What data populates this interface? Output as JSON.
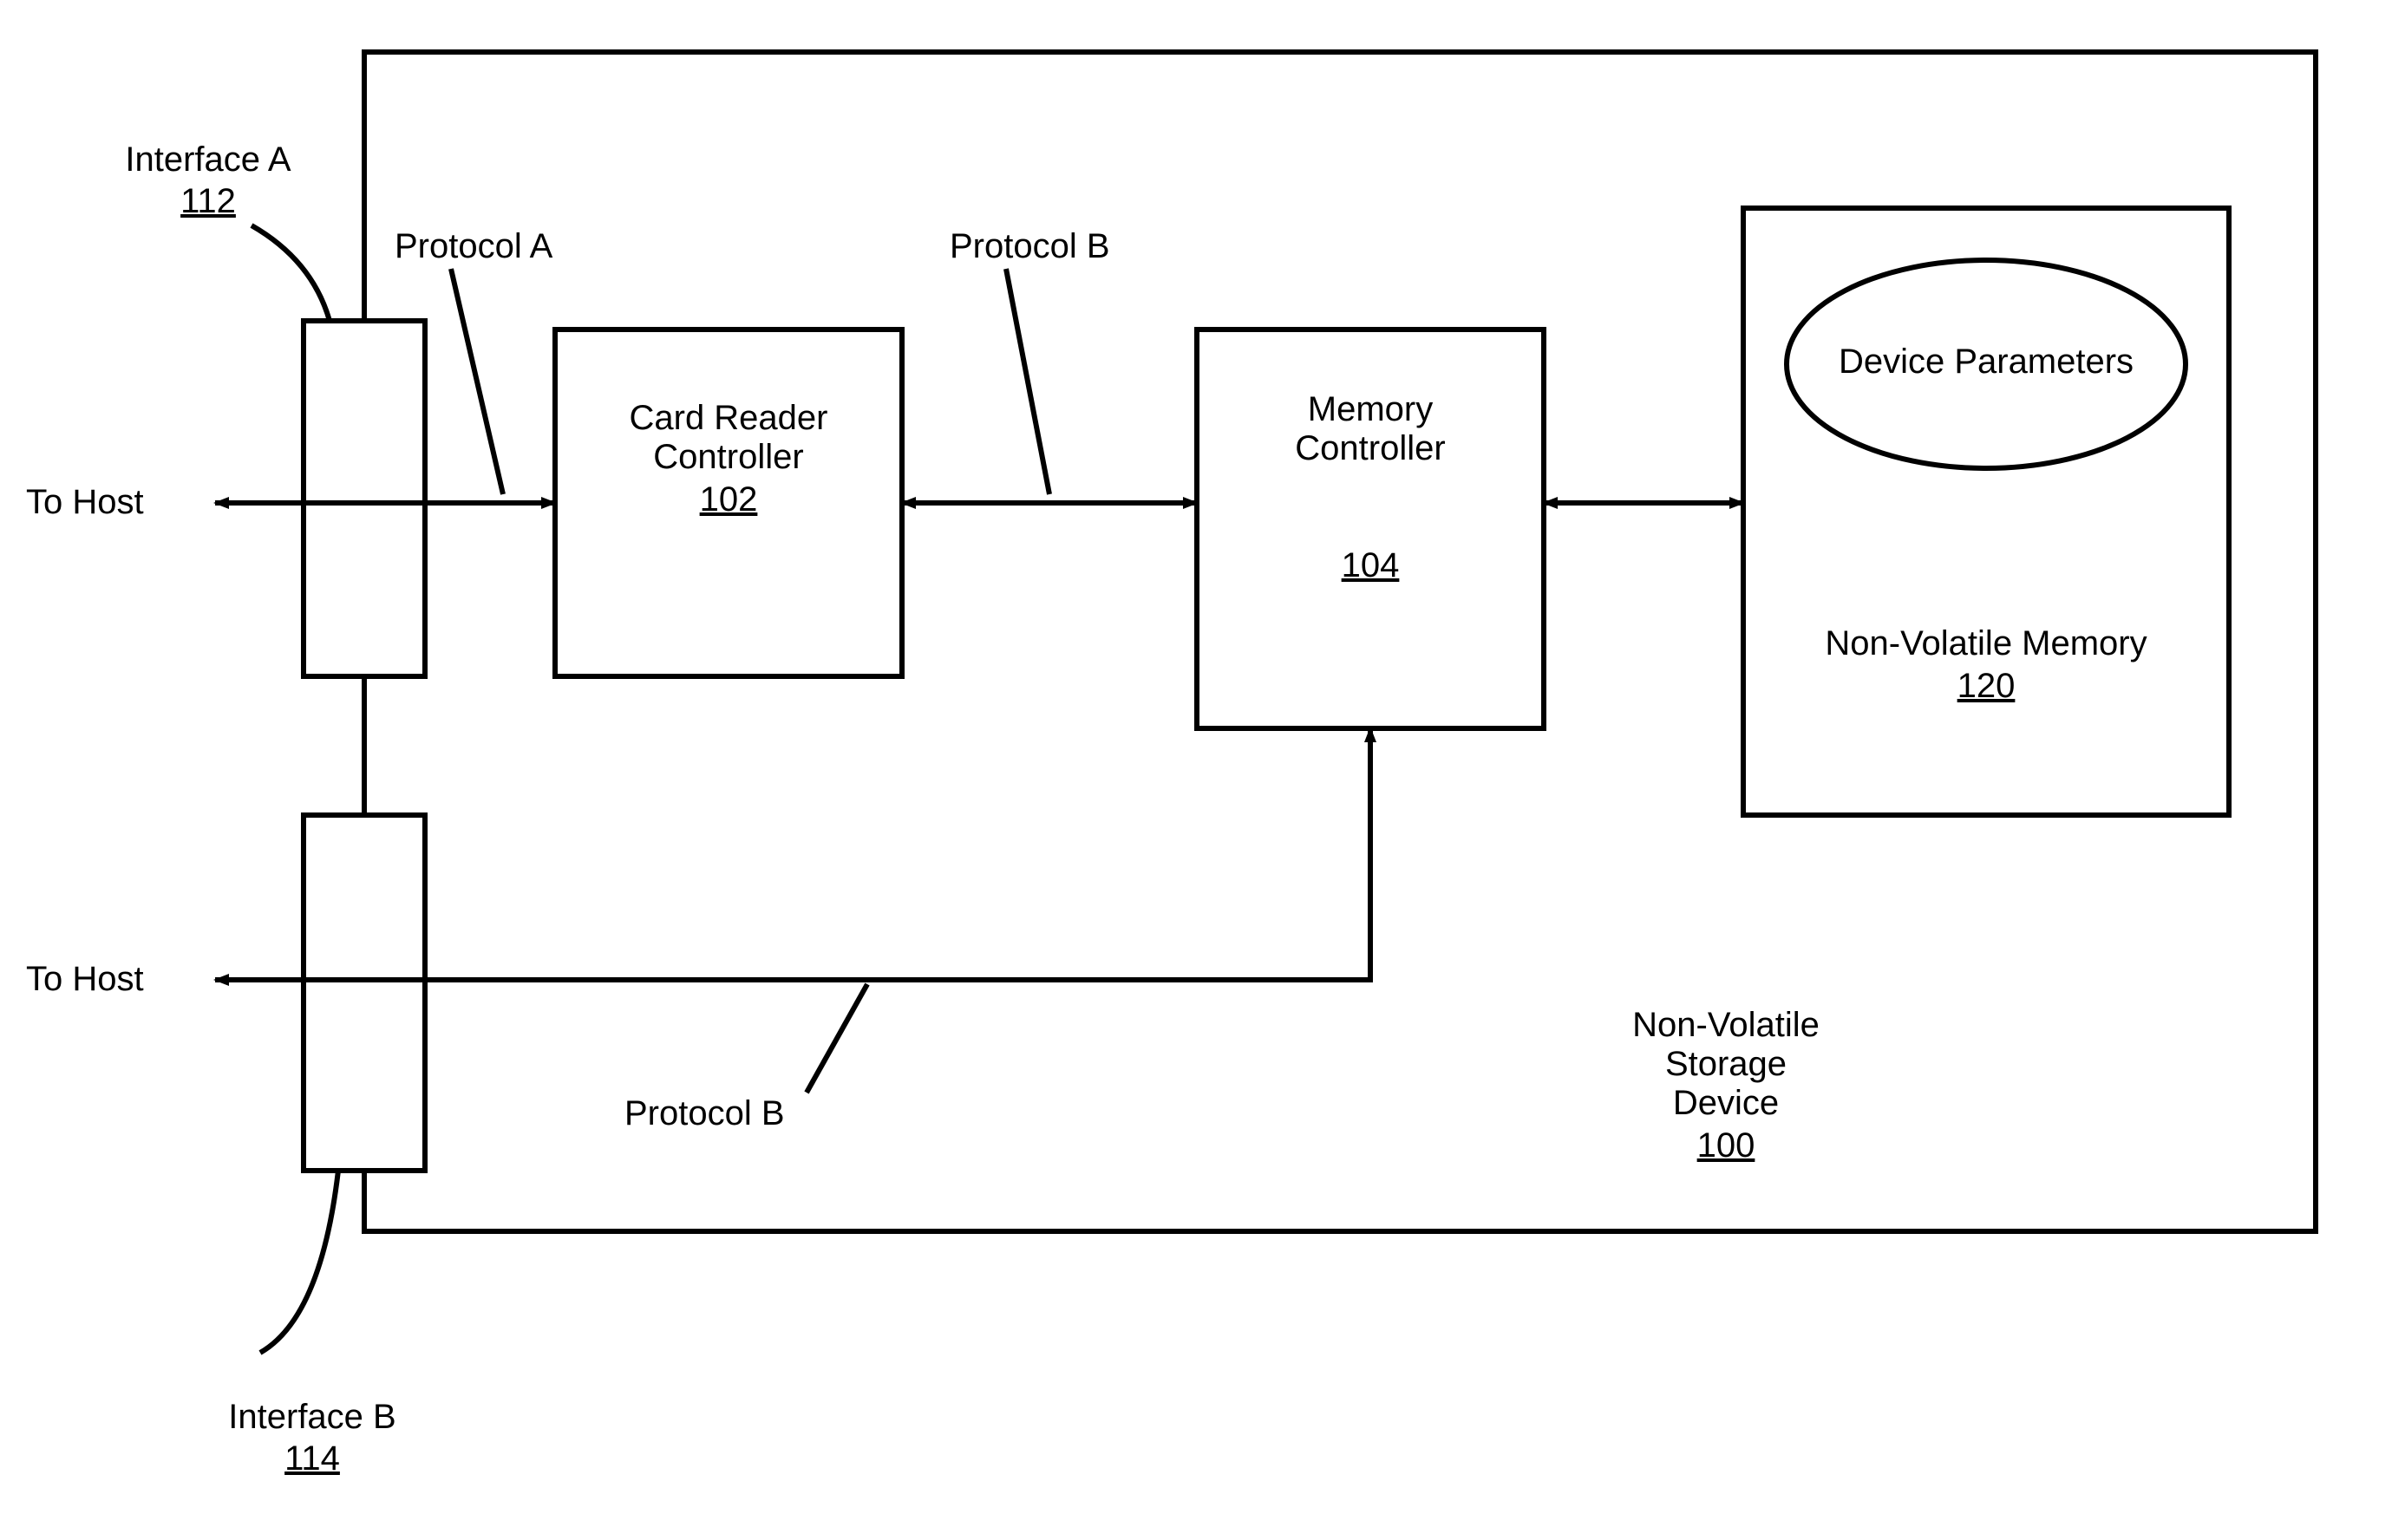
{
  "external": {
    "to_host_top": "To Host",
    "to_host_bottom": "To Host",
    "interface_a_label": "Interface A",
    "interface_a_ref": "112",
    "interface_b_label": "Interface B",
    "interface_b_ref": "114"
  },
  "protocols": {
    "a": "Protocol A",
    "b_top": "Protocol B",
    "b_bottom": "Protocol B"
  },
  "blocks": {
    "card_reader": {
      "title_line1": "Card Reader",
      "title_line2": "Controller",
      "ref": "102"
    },
    "memory_ctrl": {
      "title_line1": "Memory",
      "title_line2": "Controller",
      "ref": "104"
    },
    "nvm": {
      "title": "Non-Volatile Memory",
      "ref": "120",
      "params": "Device Parameters"
    },
    "device": {
      "line1": "Non-Volatile",
      "line2": "Storage",
      "line3": "Device",
      "ref": "100"
    }
  }
}
